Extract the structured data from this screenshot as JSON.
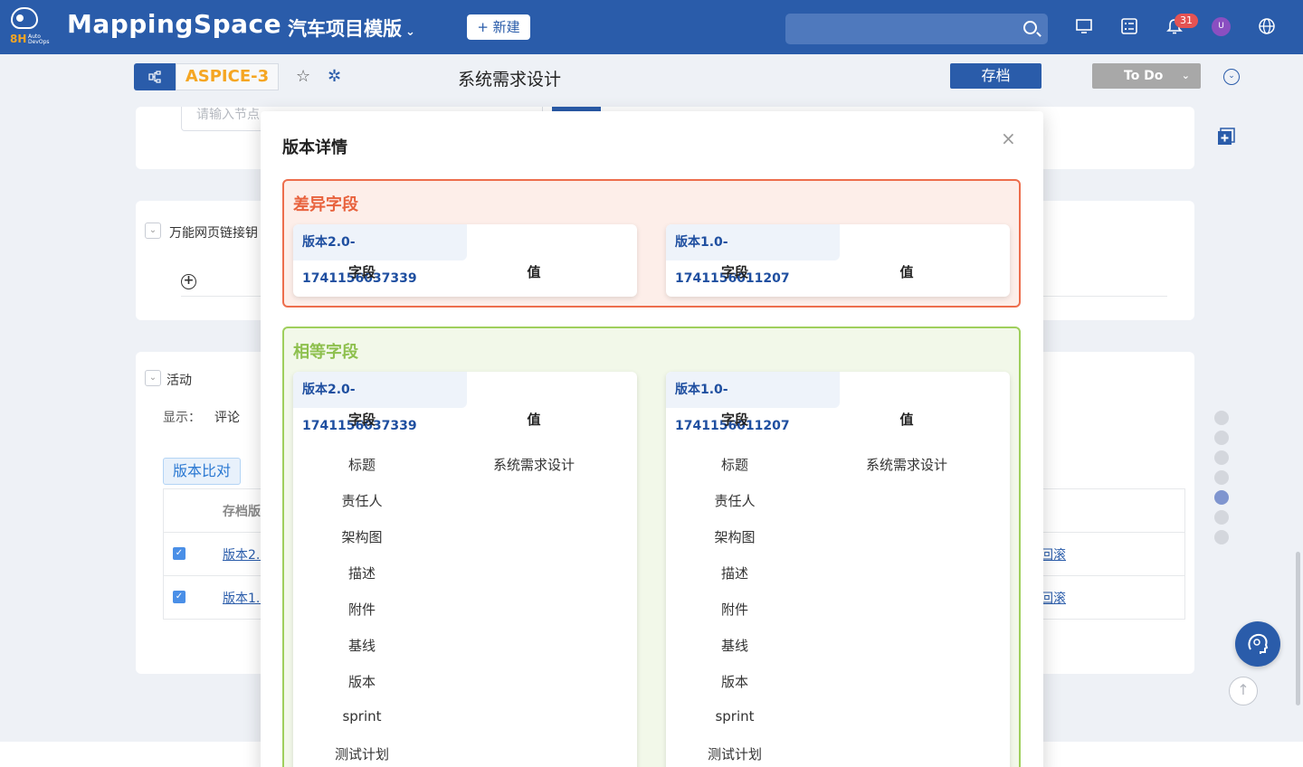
{
  "nav": {
    "logo_text": "8H",
    "logo_sub": "Auto DevOps",
    "brand": "MappingSpace",
    "project": "汽车项目模版",
    "new_button": "+ 新建",
    "search_placeholder": "",
    "notification_count": "31",
    "avatar_initial": "U",
    "icons": [
      "monitor-icon",
      "checklist-icon",
      "bell-icon",
      "globe-icon"
    ]
  },
  "toolbar": {
    "item_id": "ASPICE-3",
    "doc_title": "系统需求设计",
    "archive_button": "存档",
    "status_button": "To Do"
  },
  "background": {
    "node_input_placeholder": "请输入节点",
    "section_link_label": "万能网页链接钥",
    "section_activity": "活动",
    "display_label": "显示：",
    "display_value": "评论",
    "compare_button": "版本比对",
    "table_header": "存档版",
    "rows": [
      {
        "link": "版本2.(",
        "action": "回滚"
      },
      {
        "link": "版本1.(",
        "action": "回滚"
      }
    ]
  },
  "modal": {
    "title": "版本详情",
    "close": "×",
    "diff_group": {
      "title": "差异字段",
      "left_version": "版本2.0-1741156037339",
      "right_version": "版本1.0-1741156011207",
      "col_field": "字段",
      "col_value": "值"
    },
    "same_group": {
      "title": "相等字段",
      "left_version": "版本2.0-1741156037339",
      "right_version": "版本1.0-1741156011207",
      "col_field": "字段",
      "col_value": "值",
      "rows": [
        {
          "field": "标题",
          "value": "系统需求设计"
        },
        {
          "field": "责任人",
          "value": ""
        },
        {
          "field": "架构图",
          "value": ""
        },
        {
          "field": "描述",
          "value": ""
        },
        {
          "field": "附件",
          "value": ""
        },
        {
          "field": "基线",
          "value": ""
        },
        {
          "field": "版本",
          "value": ""
        },
        {
          "field": "sprint",
          "value": ""
        },
        {
          "field": "测试计划",
          "value": ""
        }
      ]
    }
  },
  "colors": {
    "primary": "#2a5caa",
    "accent": "#f5a623",
    "diff_border": "#ed6e4d",
    "same_border": "#9fcf5c"
  }
}
